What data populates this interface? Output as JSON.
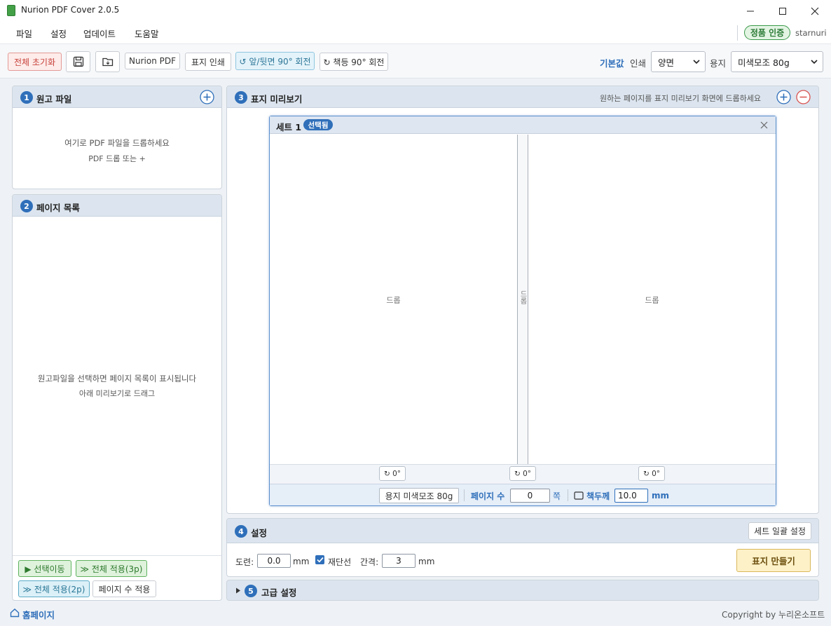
{
  "window": {
    "title": "Nurion PDF Cover 2.0.5"
  },
  "menu": {
    "items": [
      "파일",
      "설정",
      "업데이트",
      "도움말"
    ],
    "license_badge": "정품 인증",
    "username": "starnuri"
  },
  "toolbar": {
    "reset_label": "전체 초기화",
    "nurion_pdf_label": "Nurion PDF",
    "print_cover_label": "표지 인쇄",
    "rotate_front_back_label": "↺ 앞/뒷면 90° 회전",
    "rotate_spine_label": "↻ 책등 90° 회전",
    "defaults_label": "기본값",
    "print_label": "인쇄",
    "print_value": "양면",
    "paper_label": "용지",
    "paper_value": "미색모조 80g"
  },
  "panel1": {
    "number": "1",
    "title": "원고 파일",
    "hint_line1": "여기로 PDF 파일을 드롭하세요",
    "hint_line2": "PDF 드롭 또는 +"
  },
  "panel2": {
    "number": "2",
    "title": "페이지 목록",
    "hint_line1": "원고파일을 선택하면 페이지 목록이 표시됩니다",
    "hint_line2": "아래 미리보기로 드래그",
    "move_selected_label": "▶ 선택이동",
    "apply_all_3p_label": "≫ 전체 적용(3p)",
    "apply_all_2p_label": "≫ 전체 적용(2p)",
    "apply_page_count_label": "페이지 수 적용"
  },
  "panel3": {
    "number": "3",
    "title": "표지 미리보기",
    "hint": "원하는 페이지를 표지 미리보기 화면에 드롭하세요"
  },
  "set": {
    "title": "세트 1",
    "selected_badge": "선택됨",
    "back_drop": "드롭",
    "spine_drop": "드롭",
    "front_drop": "드롭",
    "rotations": [
      "↻ 0°",
      "↻ 0°",
      "↻ 0°"
    ],
    "paper_label": "용지 미색모조 80g",
    "page_count_label": "페이지 수",
    "page_count_value": "0",
    "page_unit": "쪽",
    "thickness_label": "책두께",
    "thickness_value": "10.0",
    "thickness_unit": "mm"
  },
  "panel4": {
    "number": "4",
    "title": "설정",
    "batch_settings_label": "세트 일괄 설정",
    "bleed_label": "도련:",
    "bleed_value": "0.0",
    "bleed_unit": "mm",
    "trim_marks_label": "재단선",
    "trim_marks_checked": true,
    "gap_label": "간격:",
    "gap_value": "3",
    "gap_unit": "mm",
    "make_cover_label": "표지 만들기"
  },
  "panel5": {
    "number": "5",
    "title": "고급 설정"
  },
  "footer": {
    "homepage_label": "홈페이지",
    "copyright": "Copyright by 누리온소프트"
  },
  "colors": {
    "accent": "#2f6fba",
    "reset_red": "#d9534f",
    "badge_green": "#3a9a4a",
    "make_cover_bg": "#fdf1c8"
  }
}
